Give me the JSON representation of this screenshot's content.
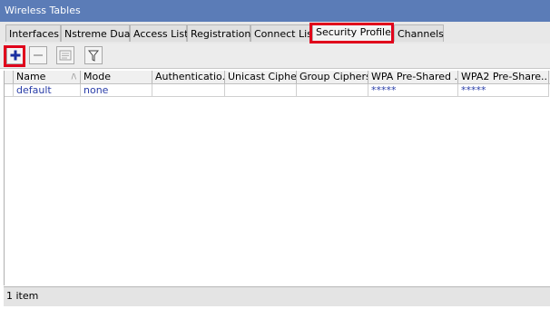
{
  "window": {
    "title": "Wireless Tables"
  },
  "tabs": [
    {
      "label": "Interfaces"
    },
    {
      "label": "Nstreme Dual"
    },
    {
      "label": "Access List"
    },
    {
      "label": "Registration"
    },
    {
      "label": "Connect List"
    },
    {
      "label": "Security Profiles",
      "active": true
    },
    {
      "label": "Channels"
    }
  ],
  "toolbar": {
    "add_icon": "plus-icon",
    "remove_icon": "minus-icon",
    "comment_icon": "comment-icon",
    "filter_icon": "filter-icon"
  },
  "table": {
    "columns": [
      "Name",
      "Mode",
      "Authenticatio...",
      "Unicast Ciphers",
      "Group Ciphers",
      "WPA Pre-Shared ...",
      "WPA2 Pre-Share..."
    ],
    "sort_indicator": "/\\",
    "rows": [
      {
        "name": "default",
        "mode": "none",
        "auth": "",
        "unicast": "",
        "group": "",
        "wpa_psk": "*****",
        "wpa2_psk": "*****"
      }
    ]
  },
  "status": {
    "text": "1 item"
  },
  "colors": {
    "titlebar": "#5b7cb7",
    "highlight": "#e0001b",
    "row_text": "#2a3ea8",
    "add_icon": "#1a2fa0"
  }
}
